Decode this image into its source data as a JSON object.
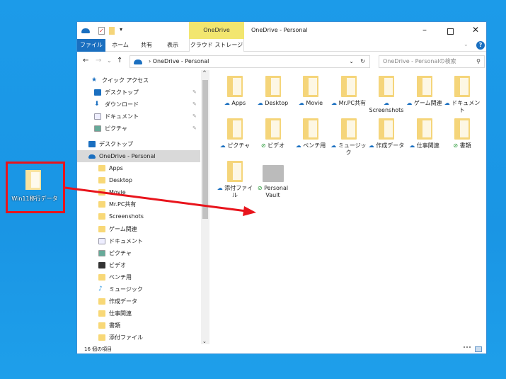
{
  "desktop": {
    "icon_label": "Win11移行データ",
    "highlight_color": "#e8141c"
  },
  "window": {
    "title": "OneDrive - Personal",
    "context_tab": "OneDrive",
    "context_subtab": "クラウド ストレージ",
    "tabs": [
      "ファイル",
      "ホーム",
      "共有",
      "表示"
    ],
    "address": "OneDrive - Personal",
    "search_placeholder": "OneDrive - Personalの検索",
    "status": "16 個の項目"
  },
  "sidebar": {
    "items": [
      {
        "label": "クイック アクセス",
        "icon": "star-icon"
      },
      {
        "label": "デスクトップ",
        "icon": "desktop-icon",
        "pinned": true
      },
      {
        "label": "ダウンロード",
        "icon": "download-icon",
        "pinned": true
      },
      {
        "label": "ドキュメント",
        "icon": "document-icon",
        "pinned": true
      },
      {
        "label": "ピクチャ",
        "icon": "picture-icon",
        "pinned": true
      },
      {
        "label": "デスクトップ",
        "icon": "desktop-icon"
      },
      {
        "label": "OneDrive - Personal",
        "icon": "cloud-icon",
        "selected": true
      },
      {
        "label": "Apps",
        "icon": "folder-icon"
      },
      {
        "label": "Desktop",
        "icon": "folder-icon"
      },
      {
        "label": "Movie",
        "icon": "folder-icon"
      },
      {
        "label": "Mr.PC共有",
        "icon": "folder-icon"
      },
      {
        "label": "Screenshots",
        "icon": "folder-icon"
      },
      {
        "label": "ゲーム関連",
        "icon": "folder-icon"
      },
      {
        "label": "ドキュメント",
        "icon": "document-icon"
      },
      {
        "label": "ピクチャ",
        "icon": "picture-icon"
      },
      {
        "label": "ビデオ",
        "icon": "video-icon"
      },
      {
        "label": "ベンチ用",
        "icon": "folder-icon"
      },
      {
        "label": "ミュージック",
        "icon": "music-icon"
      },
      {
        "label": "作成データ",
        "icon": "folder-icon"
      },
      {
        "label": "仕事関連",
        "icon": "folder-icon"
      },
      {
        "label": "書類",
        "icon": "folder-icon"
      },
      {
        "label": "添付ファイル",
        "icon": "folder-icon"
      }
    ]
  },
  "items": [
    {
      "label": "Apps",
      "status": "cloud"
    },
    {
      "label": "Desktop",
      "status": "cloud"
    },
    {
      "label": "Movie",
      "status": "cloud"
    },
    {
      "label": "Mr.PC共有",
      "status": "cloud-shared"
    },
    {
      "label": "Screenshots",
      "status": "cloud"
    },
    {
      "label": "ゲーム関連",
      "status": "cloud"
    },
    {
      "label": "ドキュメント",
      "status": "cloud"
    },
    {
      "label": "ピクチャ",
      "status": "cloud"
    },
    {
      "label": "ビデオ",
      "status": "synced"
    },
    {
      "label": "ベンチ用",
      "status": "cloud"
    },
    {
      "label": "ミュージック",
      "status": "cloud"
    },
    {
      "label": "作成データ",
      "status": "cloud"
    },
    {
      "label": "仕事関連",
      "status": "cloud"
    },
    {
      "label": "書類",
      "status": "synced"
    },
    {
      "label": "添付ファイル",
      "status": "cloud"
    },
    {
      "label": "Personal Vault",
      "status": "synced"
    }
  ]
}
